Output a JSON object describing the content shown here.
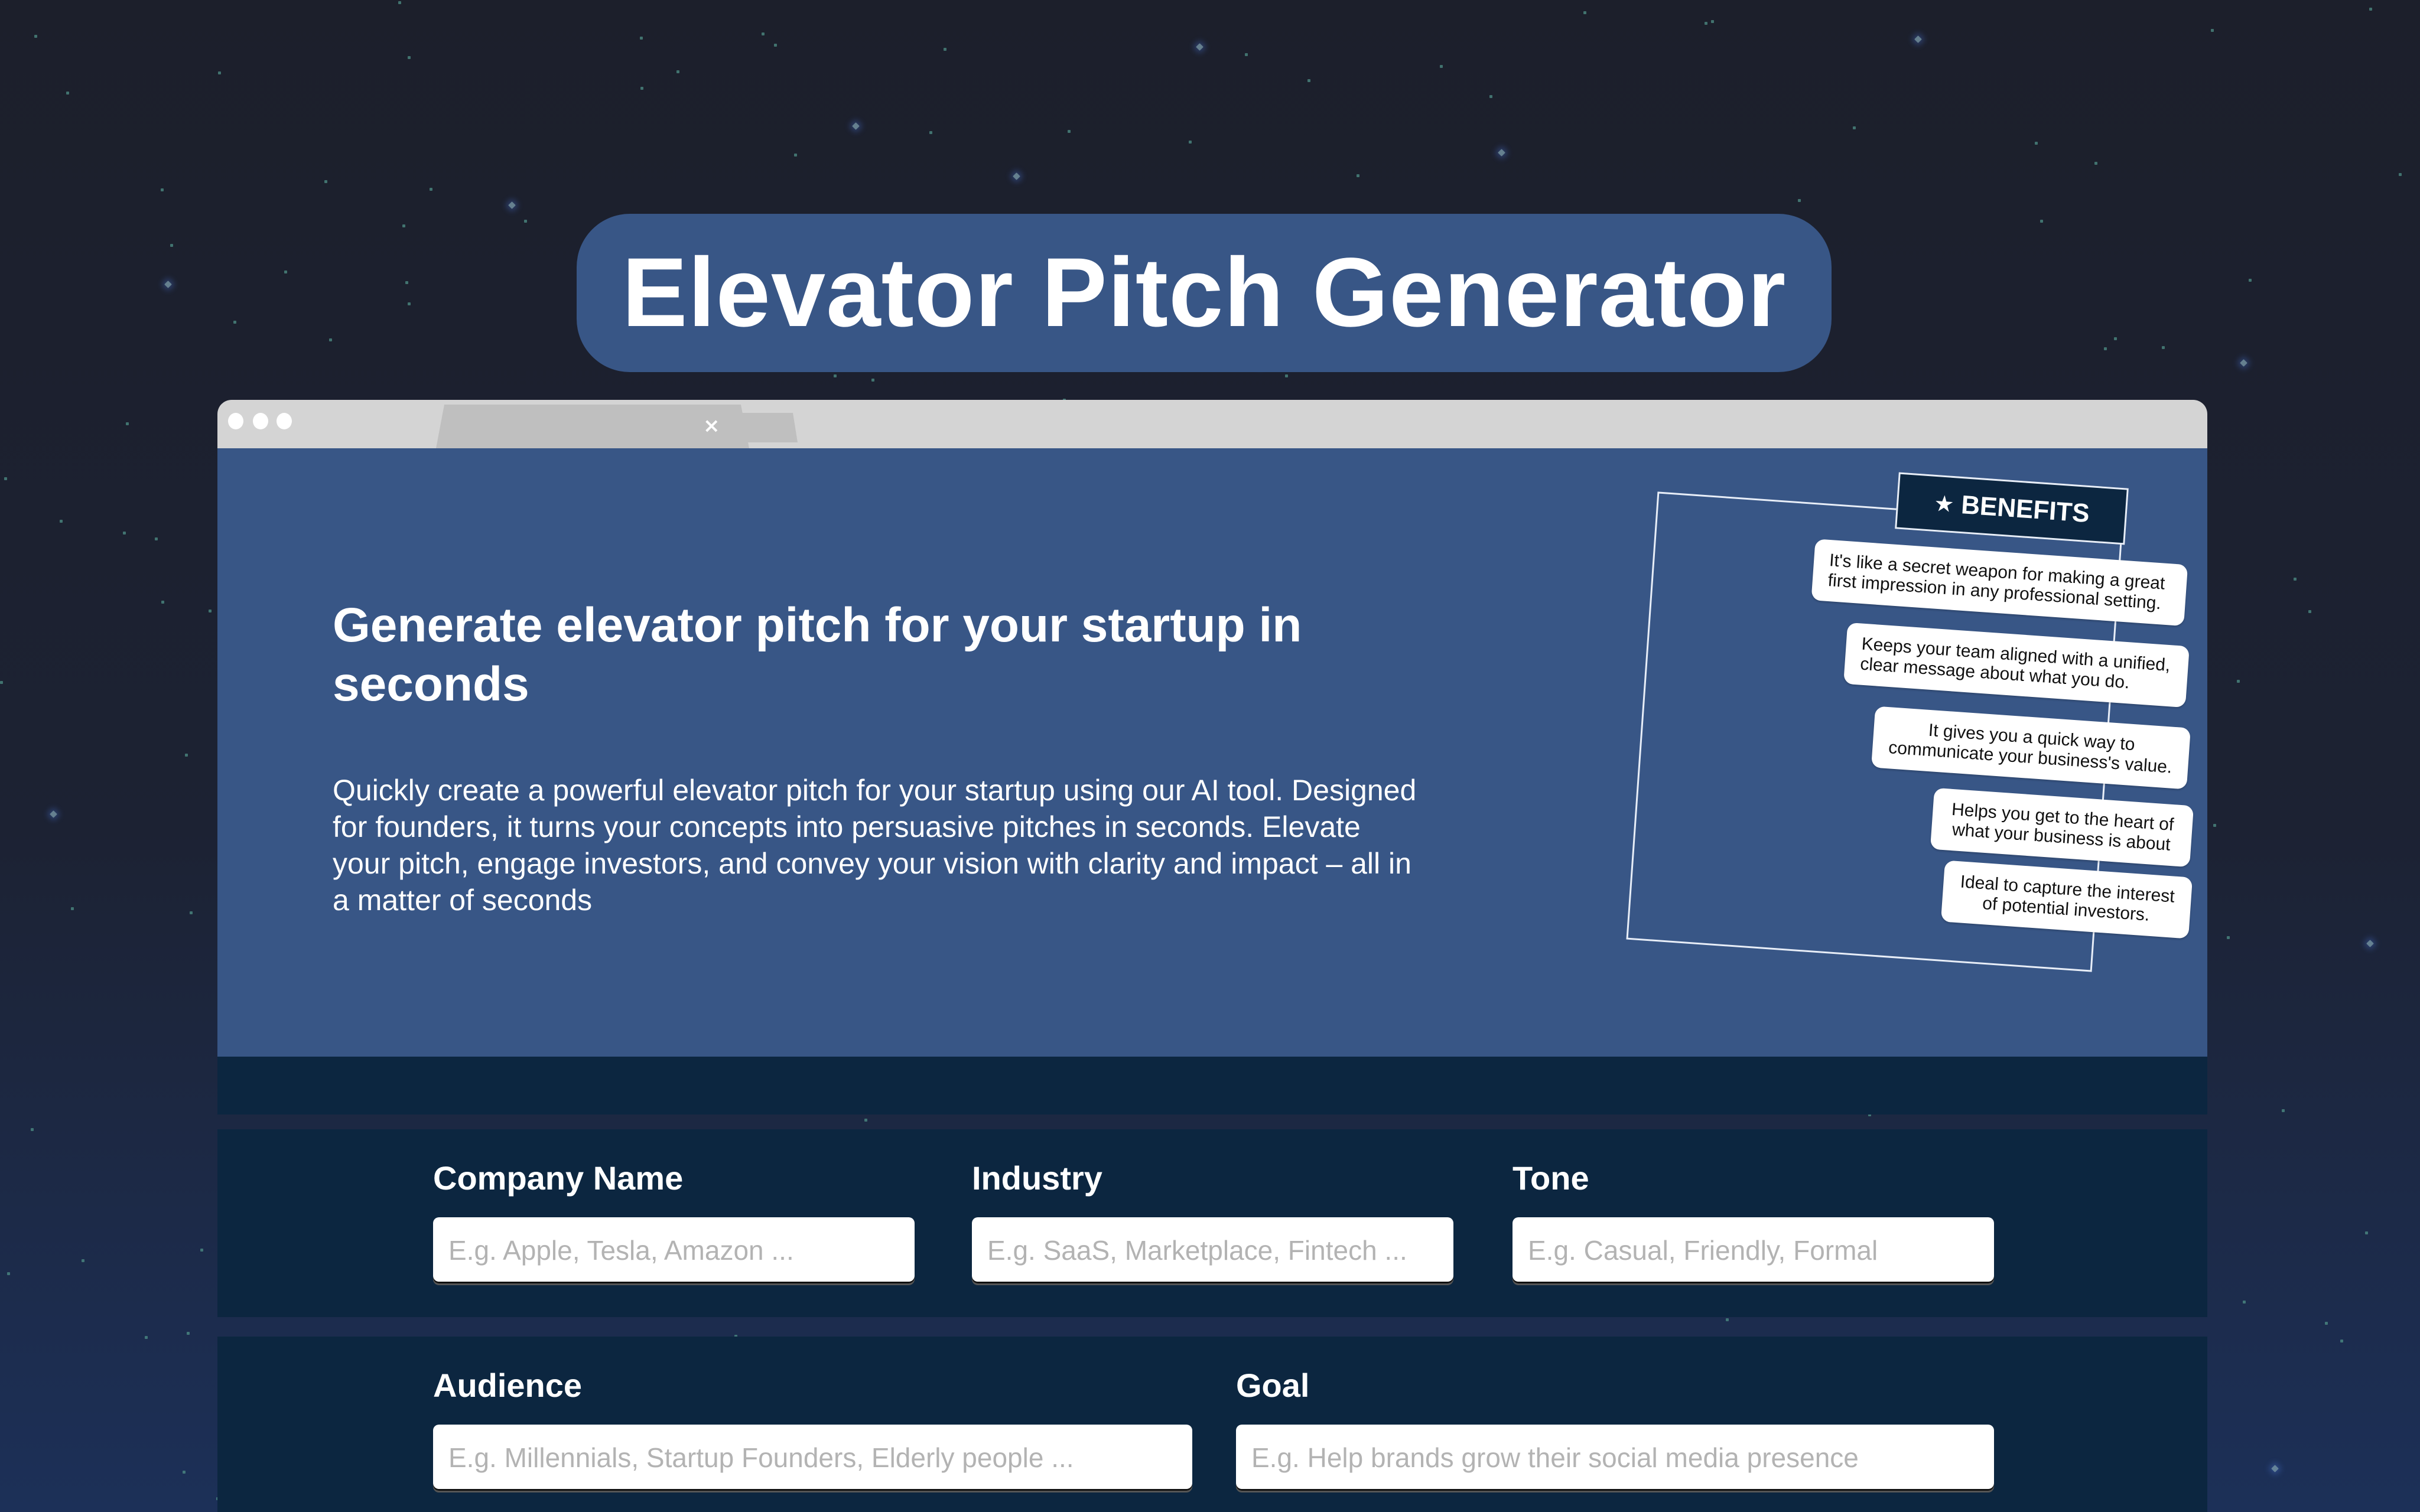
{
  "page": {
    "title": "Elevator Pitch Generator"
  },
  "browser": {
    "tab_close_icon": "×"
  },
  "hero": {
    "heading": "Generate elevator pitch for your startup in seconds",
    "description": "Quickly create a powerful elevator pitch for your startup using our AI tool. Designed for founders, it turns your concepts into persuasive pitches in seconds. Elevate your pitch, engage investors, and convey your vision with clarity and impact – all in a matter of seconds"
  },
  "benefits": {
    "tag_icon": "★",
    "tag_label": "BENEFITS",
    "items": [
      "It's like a secret weapon for making a great first impression in any professional setting.",
      "Keeps your team aligned with a unified, clear message about what you do.",
      "It gives you a quick way to communicate your business's value.",
      "Helps you get to the heart of what your business is about",
      "Ideal to capture the interest of potential investors."
    ]
  },
  "form": {
    "company_name": {
      "label": "Company Name",
      "placeholder": "E.g. Apple, Tesla, Amazon ...",
      "value": ""
    },
    "industry": {
      "label": "Industry",
      "placeholder": "E.g. SaaS, Marketplace, Fintech ...",
      "value": ""
    },
    "tone": {
      "label": "Tone",
      "placeholder": "E.g. Casual, Friendly, Formal",
      "value": ""
    },
    "audience": {
      "label": "Audience",
      "placeholder": "E.g. Millennials, Startup Founders, Elderly people ...",
      "value": ""
    },
    "goal": {
      "label": "Goal",
      "placeholder": "E.g. Help brands grow their social media presence",
      "value": ""
    }
  },
  "colors": {
    "primary_blue": "#385686",
    "navy": "#0c2640",
    "background": "#1c1f2b",
    "chrome_gray": "#d4d4d4"
  }
}
